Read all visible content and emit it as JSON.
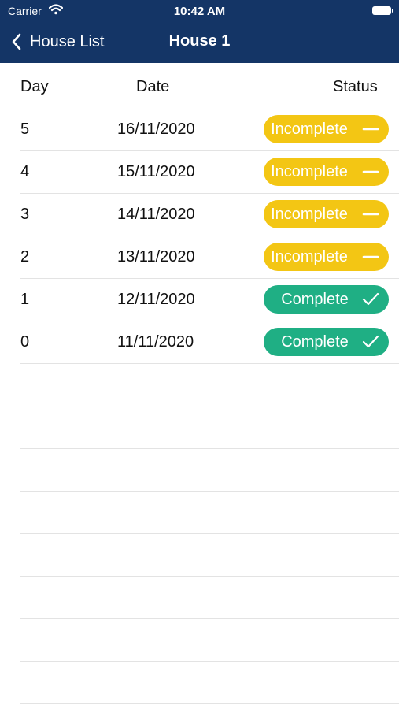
{
  "status_bar": {
    "carrier": "Carrier",
    "time": "10:42 AM"
  },
  "nav": {
    "back_label": "House List",
    "title": "House 1"
  },
  "table": {
    "headers": {
      "day": "Day",
      "date": "Date",
      "status": "Status"
    },
    "rows": [
      {
        "day": "5",
        "date": "16/11/2020",
        "status": "Incomplete",
        "state": "incomplete"
      },
      {
        "day": "4",
        "date": "15/11/2020",
        "status": "Incomplete",
        "state": "incomplete"
      },
      {
        "day": "3",
        "date": "14/11/2020",
        "status": "Incomplete",
        "state": "incomplete"
      },
      {
        "day": "2",
        "date": "13/11/2020",
        "status": "Incomplete",
        "state": "incomplete"
      },
      {
        "day": "1",
        "date": "12/11/2020",
        "status": "Complete",
        "state": "complete"
      },
      {
        "day": "0",
        "date": "11/11/2020",
        "status": "Complete",
        "state": "complete"
      }
    ]
  },
  "colors": {
    "nav_background": "#143566",
    "incomplete": "#f3c614",
    "complete": "#1faf84"
  },
  "icons": {
    "back": "chevron-left-icon",
    "incomplete": "minus-icon",
    "complete": "checkmark-icon",
    "wifi": "wifi-icon",
    "battery": "battery-icon"
  }
}
